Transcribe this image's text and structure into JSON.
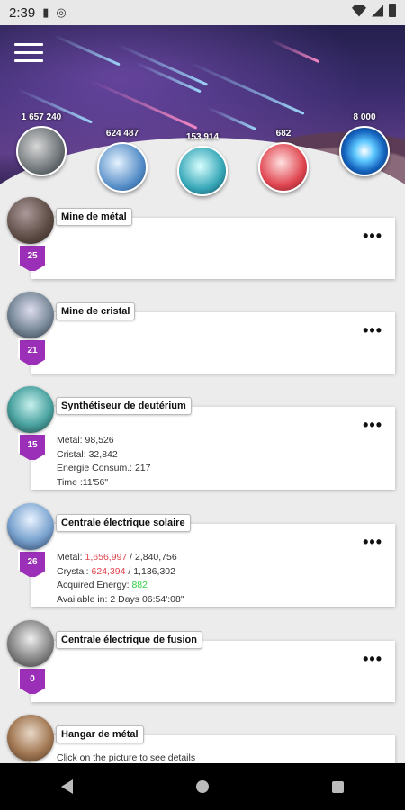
{
  "status_bar": {
    "time": "2:39"
  },
  "resources": [
    {
      "name": "metal",
      "value": "1 657 240",
      "icon": "metal-icon",
      "color": "#7f8c8d"
    },
    {
      "name": "crystal",
      "value": "624 487",
      "icon": "crystal-icon",
      "color": "#5aa0d6"
    },
    {
      "name": "deuterium",
      "value": "153 914",
      "icon": "deuterium-icon",
      "color": "#4db8c9"
    },
    {
      "name": "energy",
      "value": "682",
      "icon": "energy-icon",
      "color": "#e0454f"
    },
    {
      "name": "dark-matter",
      "value": "8 000",
      "icon": "dark-matter-icon",
      "color": "#1e7fd6"
    }
  ],
  "buildings": [
    {
      "name": "Mine de métal",
      "level": "25"
    },
    {
      "name": "Mine de cristal",
      "level": "21"
    },
    {
      "name": "Synthétiseur de deutérium",
      "level": "15",
      "details": {
        "metal_label": "Metal:",
        "metal": "98,526",
        "crystal_label": "Cristal:",
        "crystal": "32,842",
        "energy_label": "Energie Consum.:",
        "energy": "217",
        "time_label": "Time :",
        "time": "11'56\""
      }
    },
    {
      "name": "Centrale électrique solaire",
      "level": "26",
      "details": {
        "metal_label": "Metal:",
        "metal_have": "1,656,997",
        "metal_need": "2,840,756",
        "crystal_label": "Crystal:",
        "crystal_have": "624,394",
        "crystal_need": "1,136,302",
        "energy_label": "Acquired Energy:",
        "energy": "882",
        "available_label": "Available in:",
        "available": "2 Days 06:54':08\""
      }
    },
    {
      "name": "Centrale électrique de fusion",
      "level": "0"
    },
    {
      "name": "Hangar de métal",
      "level": "",
      "hint": "Click on the picture to see details"
    }
  ],
  "menu_more_label": "•••",
  "colors": {
    "level_badge": "#9b2fb8",
    "insufficient": "#e0454f",
    "sufficient": "#2fcf43"
  }
}
